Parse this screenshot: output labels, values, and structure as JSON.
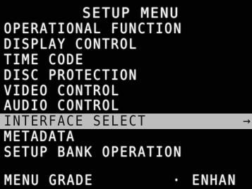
{
  "menu": {
    "title": "SETUP MENU",
    "items": [
      {
        "label": "OPERATIONAL FUNCTION"
      },
      {
        "label": "DISPLAY CONTROL"
      },
      {
        "label": "TIME CODE"
      },
      {
        "label": "DISC PROTECTION"
      },
      {
        "label": "VIDEO CONTROL"
      },
      {
        "label": "AUDIO CONTROL"
      },
      {
        "label": "INTERFACE SELECT",
        "selected": true,
        "arrow": "→"
      },
      {
        "label": "METADATA"
      },
      {
        "label": "SETUP BANK OPERATION"
      }
    ],
    "grade": {
      "label": "MENU GRADE",
      "separator": "·",
      "value": "ENHAN"
    }
  },
  "colors": {
    "background": "#020202",
    "text": "#f2f2f2",
    "highlight": "#bdbdbd",
    "selected_text": "#111111"
  }
}
